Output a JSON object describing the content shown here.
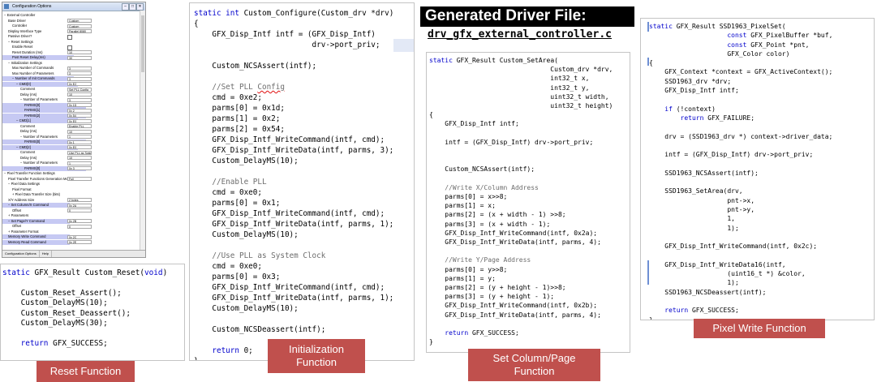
{
  "config_window": {
    "title": "Configuration Options",
    "controls": {
      "minimize": "–",
      "maximize": "□",
      "close": "✕"
    },
    "tree": [
      {
        "text": "− External Controller",
        "indent": 0
      },
      {
        "text": "Base Driver",
        "indent": 1,
        "value": "Custom"
      },
      {
        "text": "Controller",
        "indent": 2,
        "value": "Custom"
      },
      {
        "text": "Display Interface Type",
        "indent": 1,
        "value": "Parallel 8080"
      },
      {
        "text": "Passive Driver?",
        "indent": 1,
        "checkbox": true
      },
      {
        "text": "− Reset Settings",
        "indent": 1
      },
      {
        "text": "Enable Reset",
        "indent": 2,
        "checkbox": true
      },
      {
        "text": "Reset Duration (ms)",
        "indent": 2,
        "value": "10"
      },
      {
        "text": "Post Reset Delay(ms)",
        "indent": 2,
        "value": "30",
        "hl": true
      },
      {
        "text": "− Initialization Settings",
        "indent": 1
      },
      {
        "text": "Max Number of Commands",
        "indent": 2,
        "value": "3"
      },
      {
        "text": "Max Number of Parameters",
        "indent": 2,
        "value": "3"
      },
      {
        "text": "− Number of Init Commands",
        "indent": 2,
        "value": "3",
        "hl": true
      },
      {
        "text": "− CMD[0]",
        "indent": 3,
        "value": "0x E2",
        "hl": true
      },
      {
        "text": "Comment",
        "indent": 4,
        "value": "Set PLL Config"
      },
      {
        "text": "Delay (ms)",
        "indent": 4,
        "value": "10"
      },
      {
        "text": "− Number of Parameters",
        "indent": 4,
        "value": "3"
      },
      {
        "text": "PARMS[0]",
        "indent": 5,
        "value": "0x 1D",
        "hl": true
      },
      {
        "text": "PARMS[1]",
        "indent": 5,
        "value": "0x 2",
        "hl": true
      },
      {
        "text": "PARMS[2]",
        "indent": 5,
        "value": "0x 54",
        "hl": true
      },
      {
        "text": "− CMD[1]",
        "indent": 3,
        "value": "0x E0",
        "hl": true
      },
      {
        "text": "Comment",
        "indent": 4,
        "value": "Enable PLL"
      },
      {
        "text": "Delay (ms)",
        "indent": 4,
        "value": "10"
      },
      {
        "text": "− Number of Parameters",
        "indent": 4,
        "value": "1"
      },
      {
        "text": "PARMS[0]",
        "indent": 5,
        "value": "0x 1",
        "hl": true
      },
      {
        "text": "− CMD[2]",
        "indent": 3,
        "value": "0x E0",
        "hl": true
      },
      {
        "text": "Comment",
        "indent": 4,
        "value": "Use PLL as System Clock"
      },
      {
        "text": "Delay (ms)",
        "indent": 4,
        "value": "10"
      },
      {
        "text": "− Number of Parameters",
        "indent": 4,
        "value": "1"
      },
      {
        "text": "PARMS[0]",
        "indent": 5,
        "value": "0x 3",
        "hl": true
      },
      {
        "text": "− Pixel Transfer Function Settings",
        "indent": 0
      },
      {
        "text": "Pixel Transfer Functions Generation Mode",
        "indent": 1,
        "value": "Full"
      },
      {
        "text": "− Pixel Data Settings",
        "indent": 1
      },
      {
        "text": "Pixel Format",
        "indent": 2
      },
      {
        "text": "+ Pixel Data Transfer Size (bits)",
        "indent": 2
      },
      {
        "text": "X/Y Address Size",
        "indent": 1,
        "value": "2 bytes"
      },
      {
        "text": "− Set Column/X Command",
        "indent": 1,
        "value": "0x 2A",
        "hl": true
      },
      {
        "text": "Offset",
        "indent": 2,
        "value": "0"
      },
      {
        "text": "+ Parameters",
        "indent": 1
      },
      {
        "text": "− Set Page/Y Command",
        "indent": 1,
        "value": "0x 2B",
        "hl": true
      },
      {
        "text": "Offset",
        "indent": 2,
        "value": "0"
      },
      {
        "text": "+ Parameter Format",
        "indent": 1
      },
      {
        "text": "Memory Write Command",
        "indent": 1,
        "value": "0x 2C",
        "hl": true
      },
      {
        "text": "Memory Read Command",
        "indent": 1,
        "value": "0x 2E",
        "hl": true
      }
    ],
    "tabs": [
      "Configuration Options",
      "Help"
    ]
  },
  "reset_code": [
    [
      {
        "t": "static ",
        "c": "kw"
      },
      {
        "t": "GFX_Result Custom_Reset("
      },
      {
        "t": "void",
        "c": "kw"
      },
      {
        "t": ")"
      }
    ],
    [],
    [
      {
        "t": "    Custom_Reset_Assert();"
      }
    ],
    [
      {
        "t": "    Custom_DelayMS(10);"
      }
    ],
    [
      {
        "t": "    Custom_Reset_Deassert();"
      }
    ],
    [
      {
        "t": "    Custom_DelayMS(30);"
      }
    ],
    [],
    [
      {
        "t": "    "
      },
      {
        "t": "return",
        "c": "kw"
      },
      {
        "t": " GFX_SUCCESS;"
      }
    ]
  ],
  "init_code": [
    [
      {
        "t": "static int ",
        "c": "kw"
      },
      {
        "t": "Custom_Configure(Custom_drv *drv)"
      }
    ],
    [
      {
        "t": "{"
      }
    ],
    [
      {
        "t": "    GFX_Disp_Intf intf = (GFX_Disp_Intf)"
      }
    ],
    [
      {
        "t": "                          drv->port_priv;"
      }
    ],
    [],
    [
      {
        "t": "    Custom_NCSAssert(intf);"
      }
    ],
    [],
    [
      {
        "t": "    //Set PLL ",
        "c": "cm"
      },
      {
        "t": "Config",
        "c": "cm sq"
      }
    ],
    [
      {
        "t": "    cmd = 0xe2;"
      }
    ],
    [
      {
        "t": "    parms[0] = 0x1d;"
      }
    ],
    [
      {
        "t": "    parms[1] = 0x2;"
      }
    ],
    [
      {
        "t": "    parms[2] = 0x54;"
      }
    ],
    [
      {
        "t": "    GFX_Disp_Intf_WriteCommand(intf, cmd);"
      }
    ],
    [
      {
        "t": "    GFX_Disp_Intf_WriteData(intf, parms, 3);"
      }
    ],
    [
      {
        "t": "    Custom_DelayMS(10);"
      }
    ],
    [],
    [
      {
        "t": "    //Enable PLL",
        "c": "cm"
      }
    ],
    [
      {
        "t": "    cmd = 0xe0;"
      }
    ],
    [
      {
        "t": "    parms[0] = 0x1;"
      }
    ],
    [
      {
        "t": "    GFX_Disp_Intf_WriteCommand(intf, cmd);"
      }
    ],
    [
      {
        "t": "    GFX_Disp_Intf_WriteData(intf, parms, 1);"
      }
    ],
    [
      {
        "t": "    Custom_DelayMS(10);"
      }
    ],
    [],
    [
      {
        "t": "    //Use PLL as System Clock",
        "c": "cm"
      }
    ],
    [
      {
        "t": "    cmd = 0xe0;"
      }
    ],
    [
      {
        "t": "    parms[0] = 0x3;"
      }
    ],
    [
      {
        "t": "    GFX_Disp_Intf_WriteCommand(intf, cmd);"
      }
    ],
    [
      {
        "t": "    GFX_Disp_Intf_WriteData(intf, parms, 1);"
      }
    ],
    [
      {
        "t": "    Custom_DelayMS(10);"
      }
    ],
    [],
    [
      {
        "t": "    Custom_NCSDeassert(intf);"
      }
    ],
    [],
    [
      {
        "t": "    "
      },
      {
        "t": "return",
        "c": "kw"
      },
      {
        "t": " 0;"
      }
    ],
    [
      {
        "t": "}"
      }
    ]
  ],
  "setarea_code": [
    [
      {
        "t": "static ",
        "c": "kw"
      },
      {
        "t": "GFX_Result Custom_SetArea("
      }
    ],
    [
      {
        "t": "                               Custom_drv *drv,"
      }
    ],
    [
      {
        "t": "                               int32_t x,"
      }
    ],
    [
      {
        "t": "                               int32_t y,"
      }
    ],
    [
      {
        "t": "                               uint32_t width,"
      }
    ],
    [
      {
        "t": "                               uint32_t height)"
      }
    ],
    [
      {
        "t": "{"
      }
    ],
    [
      {
        "t": "    GFX_Disp_Intf intf;"
      }
    ],
    [],
    [
      {
        "t": "    intf = (GFX_Disp_Intf) drv->port_priv;"
      }
    ],
    [],
    [],
    [
      {
        "t": "    Custom_NCSAssert(intf);"
      }
    ],
    [],
    [
      {
        "t": "    //Write X/Column Address",
        "c": "cm"
      }
    ],
    [
      {
        "t": "    parms[0] = x>>8;"
      }
    ],
    [
      {
        "t": "    parms[1] = x;"
      }
    ],
    [
      {
        "t": "    parms[2] = (x + width - 1) >>8;"
      }
    ],
    [
      {
        "t": "    parms[3] = (x + width - 1);"
      }
    ],
    [
      {
        "t": "    GFX_Disp_Intf_WriteCommand(intf, 0x2a);"
      }
    ],
    [
      {
        "t": "    GFX_Disp_Intf_WriteData(intf, parms, 4);"
      }
    ],
    [],
    [
      {
        "t": "    //Write Y/Page Address",
        "c": "cm"
      }
    ],
    [
      {
        "t": "    parms[0] = y>>8;"
      }
    ],
    [
      {
        "t": "    parms[1] = y;"
      }
    ],
    [
      {
        "t": "    parms[2] = (y + height - 1)>>8;"
      }
    ],
    [
      {
        "t": "    parms[3] = (y + height - 1);"
      }
    ],
    [
      {
        "t": "    GFX_Disp_Intf_WriteCommand(intf, 0x2b);"
      }
    ],
    [
      {
        "t": "    GFX_Disp_Intf_WriteData(intf, parms, 4);"
      }
    ],
    [],
    [
      {
        "t": "    "
      },
      {
        "t": "return",
        "c": "kw"
      },
      {
        "t": " GFX_SUCCESS;"
      }
    ],
    [
      {
        "t": "}"
      }
    ]
  ],
  "pixel_code": [
    [
      {
        "t": "static ",
        "c": "kw"
      },
      {
        "t": "GFX_Result SSD1963_PixelSet("
      }
    ],
    [
      {
        "t": "                    "
      },
      {
        "t": "const",
        "c": "kw"
      },
      {
        "t": " GFX_PixelBuffer *buf,"
      }
    ],
    [
      {
        "t": "                    "
      },
      {
        "t": "const",
        "c": "kw"
      },
      {
        "t": " GFX_Point *pnt,"
      }
    ],
    [
      {
        "t": "                    GFX_Color color)"
      }
    ],
    [
      {
        "t": "{"
      }
    ],
    [
      {
        "t": "    GFX_Context *context = GFX_ActiveContext();"
      }
    ],
    [
      {
        "t": "    SSD1963_drv *drv;"
      }
    ],
    [
      {
        "t": "    GFX_Disp_Intf intf;"
      }
    ],
    [],
    [
      {
        "t": "    "
      },
      {
        "t": "if",
        "c": "kw"
      },
      {
        "t": " (!context)"
      }
    ],
    [
      {
        "t": "        "
      },
      {
        "t": "return",
        "c": "kw"
      },
      {
        "t": " GFX_FAILURE;"
      }
    ],
    [],
    [
      {
        "t": "    drv = (SSD1963_drv *) context->driver_data;"
      }
    ],
    [],
    [
      {
        "t": "    intf = (GFX_Disp_Intf) drv->port_priv;"
      }
    ],
    [],
    [
      {
        "t": "    SSD1963_NCSAssert(intf);"
      }
    ],
    [],
    [
      {
        "t": "    SSD1963_SetArea(drv,"
      }
    ],
    [
      {
        "t": "                    pnt->x,"
      }
    ],
    [
      {
        "t": "                    pnt->y,"
      }
    ],
    [
      {
        "t": "                    1,"
      }
    ],
    [
      {
        "t": "                    1);"
      }
    ],
    [],
    [
      {
        "t": "    GFX_Disp_Intf_WriteCommand(intf, 0x2c);"
      }
    ],
    [],
    [
      {
        "t": "    GFX_Disp_Intf_WriteData16(intf,"
      }
    ],
    [
      {
        "t": "                    (uint16_t *) &color,"
      }
    ],
    [
      {
        "t": "                    1);"
      }
    ],
    [
      {
        "t": "    SSD1963_NCSDeassert(intf);"
      }
    ],
    [],
    [
      {
        "t": "    "
      },
      {
        "t": "return",
        "c": "kw"
      },
      {
        "t": " GFX_SUCCESS;"
      }
    ],
    [
      {
        "t": "}"
      }
    ]
  ],
  "labels": {
    "reset": "Reset Function",
    "init": "Initialization\nFunction",
    "setarea": "Set Column/Page\nFunction",
    "pixel": "Pixel Write Function"
  },
  "header": {
    "title": "Generated Driver File:",
    "filename": "drv_gfx_external_controller.c"
  },
  "colors": {
    "label_bg": "#c0504d",
    "keyword": "#0000cc",
    "comment": "#6d6d6d",
    "highlight": "#c6c9f3"
  }
}
